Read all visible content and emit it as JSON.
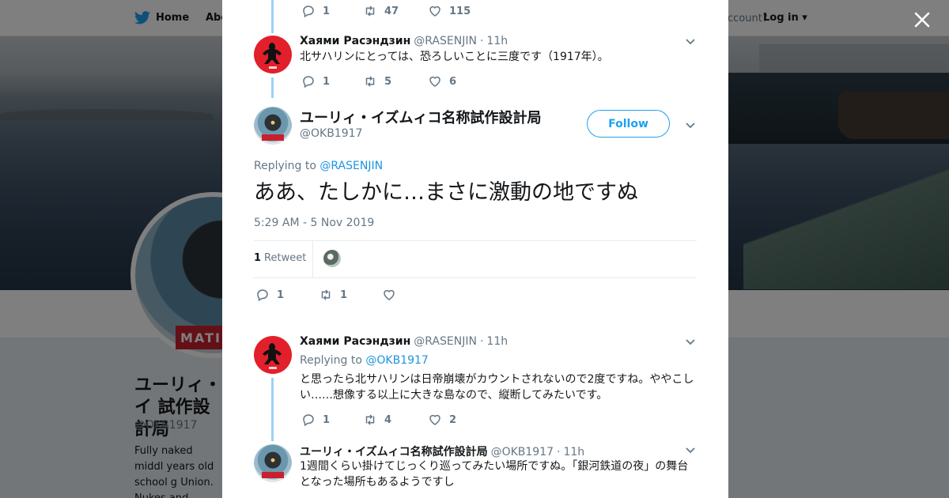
{
  "topbar": {
    "home_label": "Home",
    "about_label": "Abo",
    "account_prompt": "ccount?",
    "login_label": "Log in"
  },
  "background_profile": {
    "name": "ユーリィ・イ 試作設計局",
    "handle": "@OKB1917",
    "bio": "Fully naked middl years old school g Union. Nukes and",
    "avatar_tag": "MATI"
  },
  "modal": {
    "tweet_top_actions": {
      "replies": "1",
      "retweets": "47",
      "likes": "115"
    },
    "tweet_1": {
      "name": "Хаями Расэндзин",
      "handle": "@RASENJIN",
      "time": "11h",
      "text": "北サハリンにとっては、恐ろしいことに三度です（1917年）。",
      "actions": {
        "replies": "1",
        "retweets": "5",
        "likes": "6"
      }
    },
    "main_tweet": {
      "name": "ユーリィ・イズムィコ名称試作設計局",
      "handle": "@OKB1917",
      "follow_label": "Follow",
      "replying_prefix": "Replying to",
      "replying_to": "@RASENJIN",
      "text": "ああ、たしかに…まさに激動の地ですぬ",
      "timestamp": "5:29 AM - 5 Nov 2019",
      "retweet_count": "1",
      "retweet_label": "Retweet",
      "actions": {
        "replies": "1",
        "retweets": "1",
        "likes": ""
      }
    },
    "reply_1": {
      "name": "Хаями Расэндзин",
      "handle": "@RASENJIN",
      "time": "11h",
      "replying_prefix": "Replying to",
      "replying_to": "@OKB1917",
      "text": "と思ったら北サハリンは日帝崩壊がカウントされないので2度ですね。ややこしい……想像する以上に大きな島なので、縦断してみたいです。",
      "actions": {
        "replies": "1",
        "retweets": "4",
        "likes": "2"
      }
    },
    "reply_2": {
      "name": "ユーリィ・イズムィコ名称試作設計局",
      "handle": "@OKB1917",
      "time": "11h",
      "text": "1週間くらい掛けてじっくり巡ってみたい場所ですぬ。「銀河鉄道の夜」の舞台となった場所もあるようですし"
    }
  },
  "colors": {
    "accent": "#1da1f2",
    "link": "#1b95e0",
    "thread_line": "#9ad1f5",
    "avatar_red": "#e2202b"
  }
}
